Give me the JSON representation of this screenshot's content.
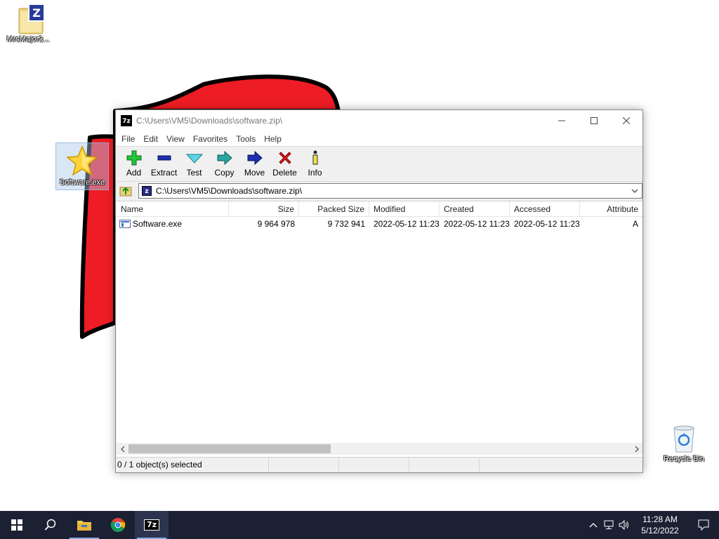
{
  "desktop": {
    "icons": [
      {
        "label": "MrsMajor2...",
        "icon": "archive-icon"
      },
      {
        "label": "Software.exe",
        "icon": "star-icon"
      },
      {
        "label": "Recycle Bin",
        "icon": "recycle-bin-icon"
      }
    ],
    "wallpaper_color": "#ee1c24"
  },
  "window": {
    "title": "C:\\Users\\VM5\\Downloads\\software.zip\\",
    "app_icon_text": "7z",
    "menu": [
      "File",
      "Edit",
      "View",
      "Favorites",
      "Tools",
      "Help"
    ],
    "toolbar": [
      {
        "label": "Add",
        "icon": "add-icon"
      },
      {
        "label": "Extract",
        "icon": "extract-icon"
      },
      {
        "label": "Test",
        "icon": "test-icon"
      },
      {
        "label": "Copy",
        "icon": "copy-icon"
      },
      {
        "label": "Move",
        "icon": "move-icon"
      },
      {
        "label": "Delete",
        "icon": "delete-icon"
      },
      {
        "label": "Info",
        "icon": "info-icon"
      }
    ],
    "address": "C:\\Users\\VM5\\Downloads\\software.zip\\",
    "columns": [
      "Name",
      "Size",
      "Packed Size",
      "Modified",
      "Created",
      "Accessed",
      "Attribute"
    ],
    "rows": [
      {
        "name": "Software.exe",
        "size": "9 964 978",
        "packed": "9 732 941",
        "modified": "2022-05-12 11:23",
        "created": "2022-05-12 11:23",
        "accessed": "2022-05-12 11:23",
        "attr": "A"
      }
    ],
    "status": "0 / 1 object(s) selected"
  },
  "taskbar": {
    "items": [
      "start-icon",
      "search-icon",
      "file-explorer-icon",
      "chrome-icon",
      "7zip-icon"
    ],
    "app_7z_text": "7z",
    "clock": {
      "time": "11:28 AM",
      "date": "5/12/2022"
    },
    "colors": {
      "bar": "#1c2033",
      "indicator": "#8aa9e0"
    }
  }
}
